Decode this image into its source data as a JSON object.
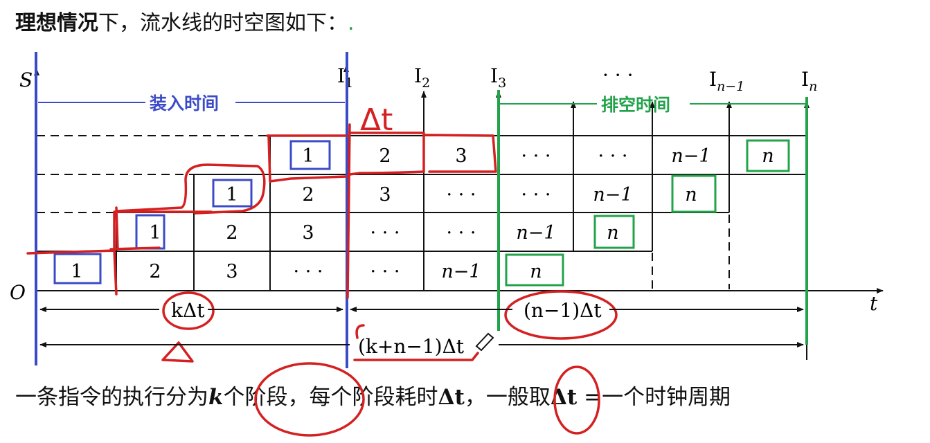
{
  "header": {
    "title_bold": "理想情况",
    "title_rest": "下，流水线的时空图如下：",
    "trailing_mark": "."
  },
  "diagram": {
    "axis_s": "S",
    "axis_o": "O",
    "axis_t": "t",
    "instructions": {
      "i1": "I",
      "i1_sub": "1",
      "i2": "I",
      "i2_sub": "2",
      "i3": "I",
      "i3_sub": "3",
      "dots": "· · ·",
      "in1": "I",
      "in1_sub": "n−1",
      "in": "I",
      "in_sub": "n"
    },
    "load_time_label": "装入时间",
    "drain_time_label": "排空时间",
    "handwritten_dt": "Δt",
    "cells": {
      "one": "1",
      "two": "2",
      "three": "3",
      "dots": "· · ·",
      "n1": "n−1",
      "n": "n"
    },
    "dim_k": "kΔt",
    "dim_n1": "(n−1)Δt",
    "dim_total": "(k+n−1)Δt"
  },
  "footer": {
    "p1": "一条指令的执行分为",
    "k": "k",
    "p2": "个阶段，每个阶段耗时",
    "dt": "Δt",
    "p3": "，一般取",
    "dt2": "Δt",
    "p4": " =一个时钟周期"
  }
}
